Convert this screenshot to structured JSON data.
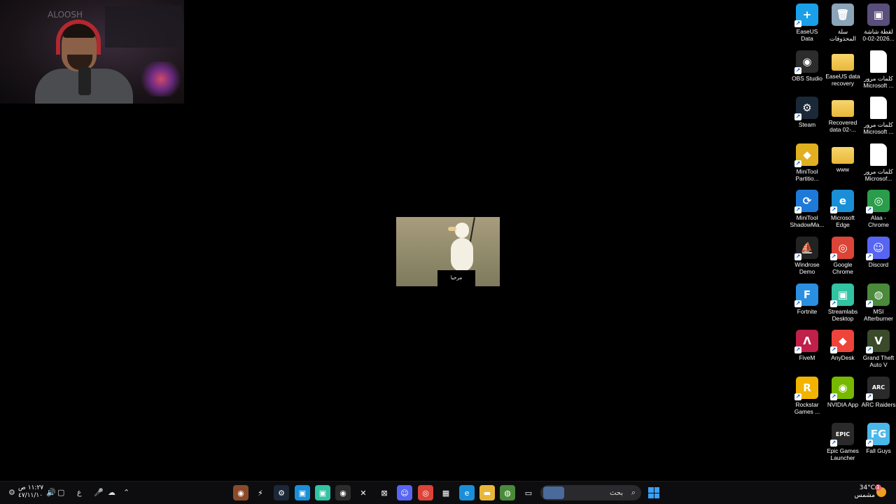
{
  "webcam": {
    "watermark": "ALOOSH"
  },
  "gif": {
    "caption": "مرحبا"
  },
  "desktop_icons": [
    {
      "label": "EaseUS Data Recovery ...",
      "icon": "easeus-icon",
      "color": "#1aa0e8",
      "glyph": "+"
    },
    {
      "label": "سلة المحذوفات",
      "icon": "recycle-bin-icon",
      "color": "#8aa4b8",
      "glyph": "🗑"
    },
    {
      "label": "لقطة شاشة 2026-02-0...",
      "icon": "screenshot-file-icon",
      "color": "#5a4e7a",
      "glyph": "▣"
    },
    {
      "label": "OBS Studio",
      "icon": "obs-icon",
      "color": "#2c2c2c",
      "glyph": "◉"
    },
    {
      "label": "EaseUS data recovery",
      "icon": "folder-icon",
      "color": "#e8b73a",
      "glyph": ""
    },
    {
      "label": "كلمات مرور Microsoft ...",
      "icon": "document-icon",
      "color": "#ffffff",
      "glyph": ""
    },
    {
      "label": "Steam",
      "icon": "steam-icon",
      "color": "#1b2838",
      "glyph": "⚙"
    },
    {
      "label": "Recovered data 02-...",
      "icon": "folder-icon",
      "color": "#e8b73a",
      "glyph": ""
    },
    {
      "label": "كلمات مرور Microsoft ...",
      "icon": "document-icon",
      "color": "#ffffff",
      "glyph": ""
    },
    {
      "label": "MiniTool Partitio...",
      "icon": "minitool-partition-icon",
      "color": "#e0b020",
      "glyph": "◆"
    },
    {
      "label": "www",
      "icon": "folder-icon",
      "color": "#e8b73a",
      "glyph": ""
    },
    {
      "label": "كلمات مرور Microsof...",
      "icon": "document-icon",
      "color": "#ffffff",
      "glyph": ""
    },
    {
      "label": "MiniTool ShadowMa...",
      "icon": "minitool-shadowmaker-icon",
      "color": "#1e7ad8",
      "glyph": "⟳"
    },
    {
      "label": "Microsoft Edge",
      "icon": "edge-icon",
      "color": "#1a8fd8",
      "glyph": "e"
    },
    {
      "label": "Alaa - Chrome",
      "icon": "chrome-profile-icon",
      "color": "#2a9d4a",
      "glyph": "◎"
    },
    {
      "label": "Windrose Demo",
      "icon": "windrose-icon",
      "color": "#222222",
      "glyph": "⛵"
    },
    {
      "label": "Google Chrome",
      "icon": "chrome-icon",
      "color": "#db4437",
      "glyph": "◎"
    },
    {
      "label": "Discord",
      "icon": "discord-icon",
      "color": "#5865f2",
      "glyph": "☺"
    },
    {
      "label": "Fortnite",
      "icon": "fortnite-icon",
      "color": "#2a8fe0",
      "glyph": "F"
    },
    {
      "label": "Streamlabs Desktop",
      "icon": "streamlabs-icon",
      "color": "#31c3a2",
      "glyph": "▣"
    },
    {
      "label": "MSI Afterburner",
      "icon": "msi-afterburner-icon",
      "color": "#4a8a3a",
      "glyph": "◍"
    },
    {
      "label": "FiveM",
      "icon": "fivem-icon",
      "color": "#c0204a",
      "glyph": "Λ"
    },
    {
      "label": "AnyDesk",
      "icon": "anydesk-icon",
      "color": "#ef443b",
      "glyph": "◆"
    },
    {
      "label": "Grand Theft Auto V",
      "icon": "gta-icon",
      "color": "#3a4a2a",
      "glyph": "V"
    },
    {
      "label": "Rockstar Games ...",
      "icon": "rockstar-icon",
      "color": "#f2b400",
      "glyph": "R"
    },
    {
      "label": "NVIDIA App",
      "icon": "nvidia-icon",
      "color": "#76b900",
      "glyph": "◉"
    },
    {
      "label": "ARC Raiders",
      "icon": "arc-raiders-icon",
      "color": "#2a2a2a",
      "glyph": "ARC"
    },
    {
      "label": "Epic Games Launcher",
      "icon": "epic-games-icon",
      "color": "#2a2a2a",
      "glyph": "EPIC"
    },
    {
      "label": "Fall Guys",
      "icon": "fall-guys-icon",
      "color": "#4ab8e8",
      "glyph": "FG"
    }
  ],
  "taskbar": {
    "clock_time": "١١:٢٧ ص",
    "clock_date": "٤٧/١١/١٠",
    "language": "ع",
    "search_placeholder": "بحث",
    "weather_temp": "34°C",
    "weather_desc": "مشمس",
    "notification_count": "1",
    "apps": [
      {
        "name": "app-1",
        "color": "#8a4a2a",
        "glyph": "◉"
      },
      {
        "name": "app-2",
        "color": "#0d0d0f",
        "glyph": "⚡"
      },
      {
        "name": "steam",
        "color": "#1b2838",
        "glyph": "⚙"
      },
      {
        "name": "app-4",
        "color": "#1a8fd8",
        "glyph": "▣"
      },
      {
        "name": "streamlabs",
        "color": "#31c3a2",
        "glyph": "▣"
      },
      {
        "name": "obs",
        "color": "#2c2c2c",
        "glyph": "◉"
      },
      {
        "name": "x",
        "color": "#0d0d0f",
        "glyph": "✕"
      },
      {
        "name": "xbox",
        "color": "#0d0d0f",
        "glyph": "⊠"
      },
      {
        "name": "discord",
        "color": "#5865f2",
        "glyph": "☺"
      },
      {
        "name": "chrome",
        "color": "#db4437",
        "glyph": "◎"
      },
      {
        "name": "store",
        "color": "#0d0d0f",
        "glyph": "▦"
      },
      {
        "name": "edge",
        "color": "#1a8fd8",
        "glyph": "e"
      },
      {
        "name": "explorer",
        "color": "#e8b73a",
        "glyph": "▬"
      },
      {
        "name": "msi",
        "color": "#4a8a3a",
        "glyph": "◍"
      },
      {
        "name": "window",
        "color": "#0d0d0f",
        "glyph": "▭"
      }
    ]
  }
}
